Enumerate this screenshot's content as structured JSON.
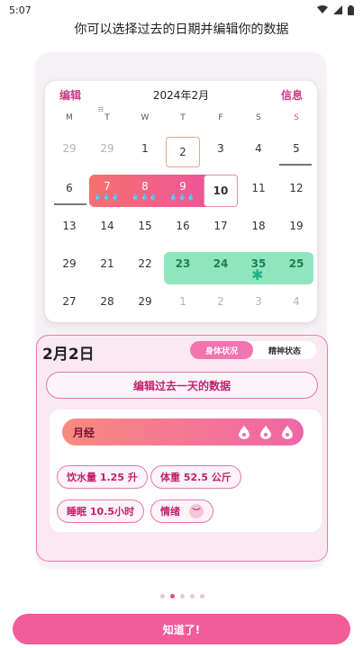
{
  "status_bar": {
    "time": "5:07",
    "icons": [
      "wifi-icon",
      "signal-icon",
      "battery-icon"
    ]
  },
  "headline": "你可以选择过去的日期并编辑你的数据",
  "calendar": {
    "edit_label": "编辑",
    "title": "2024年2月",
    "info_label": "信息",
    "weekdays": [
      "M",
      "T",
      "W",
      "T",
      "F",
      "S",
      "S"
    ],
    "weekday_marker": "☷",
    "weeks": [
      [
        "29",
        "29",
        "1",
        "2",
        "3",
        "4",
        "5"
      ],
      [
        "6",
        "7",
        "8",
        "9",
        "10",
        "11",
        "12"
      ],
      [
        "13",
        "14",
        "15",
        "16",
        "17",
        "18",
        "19"
      ],
      [
        "29",
        "21",
        "22",
        "23",
        "24",
        "35",
        "25"
      ],
      [
        "27",
        "28",
        "29",
        "1",
        "2",
        "3",
        "4"
      ]
    ],
    "period_drops": "💧💧💧",
    "fertile_star": "✱"
  },
  "detail": {
    "date": "2月2日",
    "tabs": [
      "身体状况",
      "精神状态"
    ],
    "edit_past_label": "编辑过去一天的数据",
    "period_label": "月经",
    "period_drops": [
      "💧",
      "💧",
      "💧"
    ],
    "water": "饮水量 1.25 升",
    "weight": "体重 52.5 公斤",
    "sleep": "睡眠 10.5小时",
    "mood": "情绪"
  },
  "pager": {
    "count": 5,
    "active": 1
  },
  "cta_label": "知道了!",
  "colors": {
    "accent": "#f25c98",
    "period": "#f066a6",
    "fertile": "#8fe6bd"
  }
}
